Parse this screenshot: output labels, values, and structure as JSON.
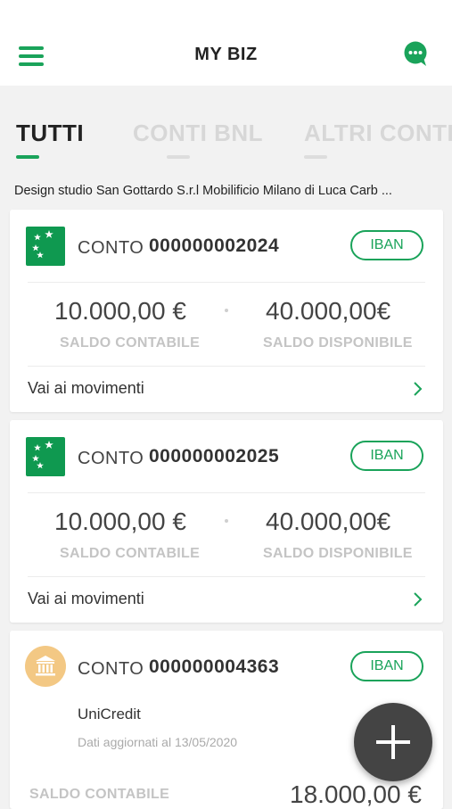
{
  "header": {
    "title": "MY BIZ",
    "menu_icon": "hamburger-menu-icon",
    "chat_icon": "chat-bubble-icon",
    "accent_color": "#1aa35a"
  },
  "tabs": [
    {
      "label": "TUTTI",
      "active": true
    },
    {
      "label": "CONTI BNL",
      "active": false
    },
    {
      "label": "ALTRI CONTI",
      "active": false
    }
  ],
  "companies_line": "Design studio San Gottardo S.r.l Mobilificio Milano di Luca Carb ...",
  "accounts": [
    {
      "conto_label": "CONTO",
      "number": "000000002024",
      "iban_label": "IBAN",
      "saldo_contabile": "10.000,00 €",
      "saldo_contabile_label": "SALDO CONTABILE",
      "saldo_disponibile": "40.000,00€",
      "saldo_disponibile_label": "SALDO DISPONIBILE",
      "movements_link": "Vai ai movimenti",
      "logo": "bnl-flag-icon"
    },
    {
      "conto_label": "CONTO",
      "number": "000000002025",
      "iban_label": "IBAN",
      "saldo_contabile": "10.000,00 €",
      "saldo_contabile_label": "SALDO CONTABILE",
      "saldo_disponibile": "40.000,00€",
      "saldo_disponibile_label": "SALDO DISPONIBILE",
      "movements_link": "Vai ai movimenti",
      "logo": "bnl-flag-icon"
    },
    {
      "conto_label": "CONTO",
      "number": "000000004363",
      "iban_label": "IBAN",
      "bank_name": "UniCredit",
      "updated": "Dati aggiornati al 13/05/2020",
      "saldo_contabile_label": "SALDO CONTABILE",
      "saldo_contabile": "18.000,00 €",
      "logo": "bank-building-icon"
    }
  ],
  "fab": {
    "icon": "plus-icon"
  }
}
